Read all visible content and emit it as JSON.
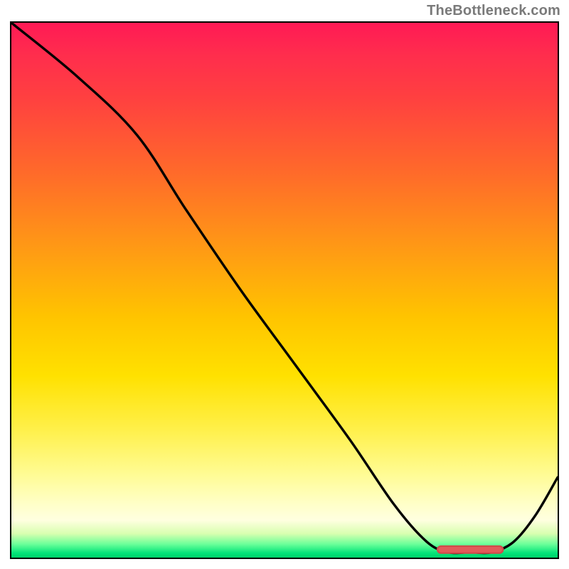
{
  "watermark": "TheBottleneck.com",
  "colors": {
    "gradient_top": "#ff1a55",
    "gradient_mid": "#ffe100",
    "gradient_bottom": "#00d26a",
    "curve": "#000000",
    "pill": "#e25a5a"
  },
  "chart_data": {
    "type": "line",
    "title": "",
    "xlabel": "",
    "ylabel": "",
    "xlim": [
      0,
      100
    ],
    "ylim": [
      0,
      100
    ],
    "grid": false,
    "legend": false,
    "series": [
      {
        "name": "bottleneck-curve",
        "x": [
          0,
          12,
          23,
          32,
          42,
          52,
          62,
          70,
          76,
          80,
          84,
          88,
          92,
          96,
          100
        ],
        "values": [
          100,
          90,
          79,
          65,
          50,
          36,
          22,
          10,
          3,
          1,
          1,
          1,
          3,
          8,
          15
        ]
      }
    ],
    "marker": {
      "name": "bottleneck-region",
      "x_start": 78,
      "x_end": 90,
      "y": 1.5
    }
  }
}
